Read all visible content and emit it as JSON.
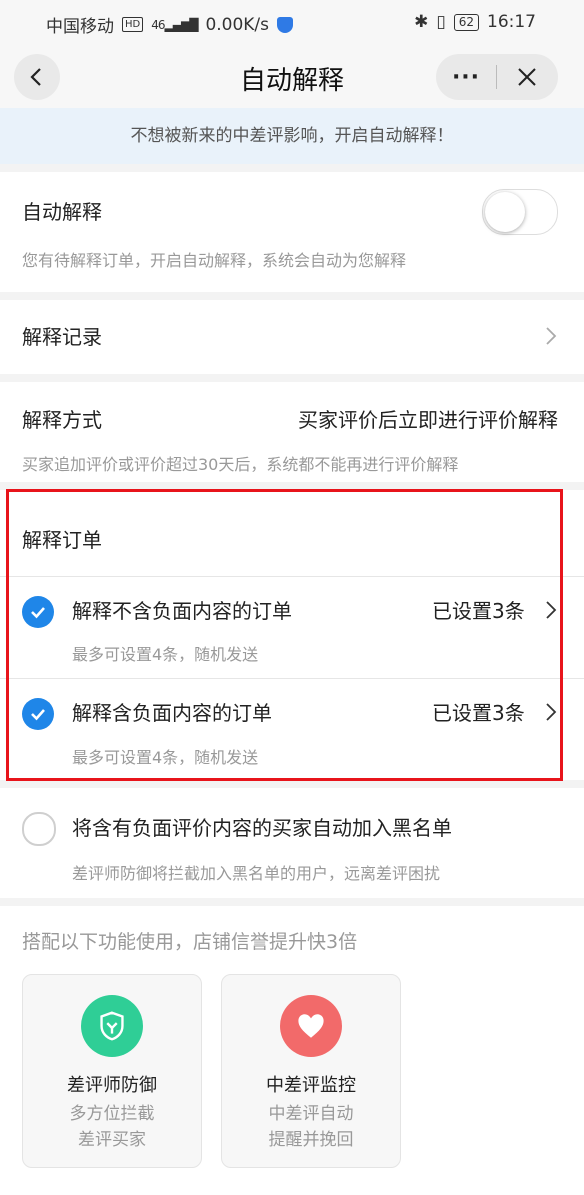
{
  "status_bar": {
    "carrier": "中国移动",
    "hd": "HD",
    "network": "46",
    "speed": "0.00K/s",
    "battery": "62",
    "time": "16:17"
  },
  "nav": {
    "title": "自动解释",
    "more": "···"
  },
  "banner": "不想被新来的中差评影响，开启自动解释！",
  "auto_explain": {
    "label": "自动解释",
    "desc": "您有待解释订单，开启自动解释，系统会自动为您解释",
    "enabled": false
  },
  "records": {
    "label": "解释记录"
  },
  "method": {
    "label": "解释方式",
    "value": "买家评价后立即进行评价解释",
    "desc": "买家追加评价或评价超过30天后，系统都不能再进行评价解释"
  },
  "orders": {
    "header": "解释订单",
    "items": [
      {
        "label": "解释不含负面内容的订单",
        "status": "已设置3条",
        "desc": "最多可设置4条，随机发送",
        "checked": true
      },
      {
        "label": "解释含负面内容的订单",
        "status": "已设置3条",
        "desc": "最多可设置4条，随机发送",
        "checked": true
      }
    ]
  },
  "blacklist": {
    "label": "将含有负面评价内容的买家自动加入黑名单",
    "desc": "差评师防御将拦截加入黑名单的用户，远离差评困扰",
    "checked": false
  },
  "combo": {
    "title": "搭配以下功能使用，店铺信誉提升快3倍",
    "features": [
      {
        "name": "差评师防御",
        "desc": "多方位拦截差评买家",
        "icon": "shield-icon",
        "color": "#2fce96"
      },
      {
        "name": "中差评监控",
        "desc": "中差评自动提醒并挽回",
        "icon": "heart-icon",
        "color": "#f26a6a"
      }
    ]
  }
}
